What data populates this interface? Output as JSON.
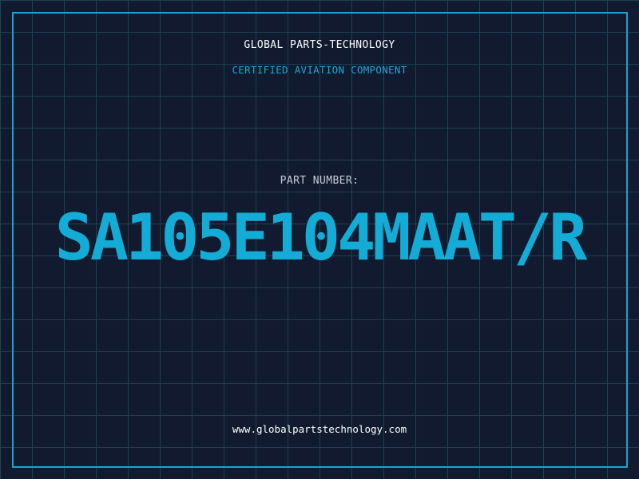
{
  "header": {
    "company": "GLOBAL PARTS-TECHNOLOGY",
    "subtitle": "CERTIFIED AVIATION COMPONENT"
  },
  "main": {
    "label": "PART NUMBER:",
    "part_number": "SA105E104MAAT/R"
  },
  "footer": {
    "url": "www.globalpartstechnology.com"
  },
  "colors": {
    "background": "#111a2e",
    "grid": "#1b4256",
    "accent": "#12acd6",
    "border": "#1aa3cc"
  }
}
